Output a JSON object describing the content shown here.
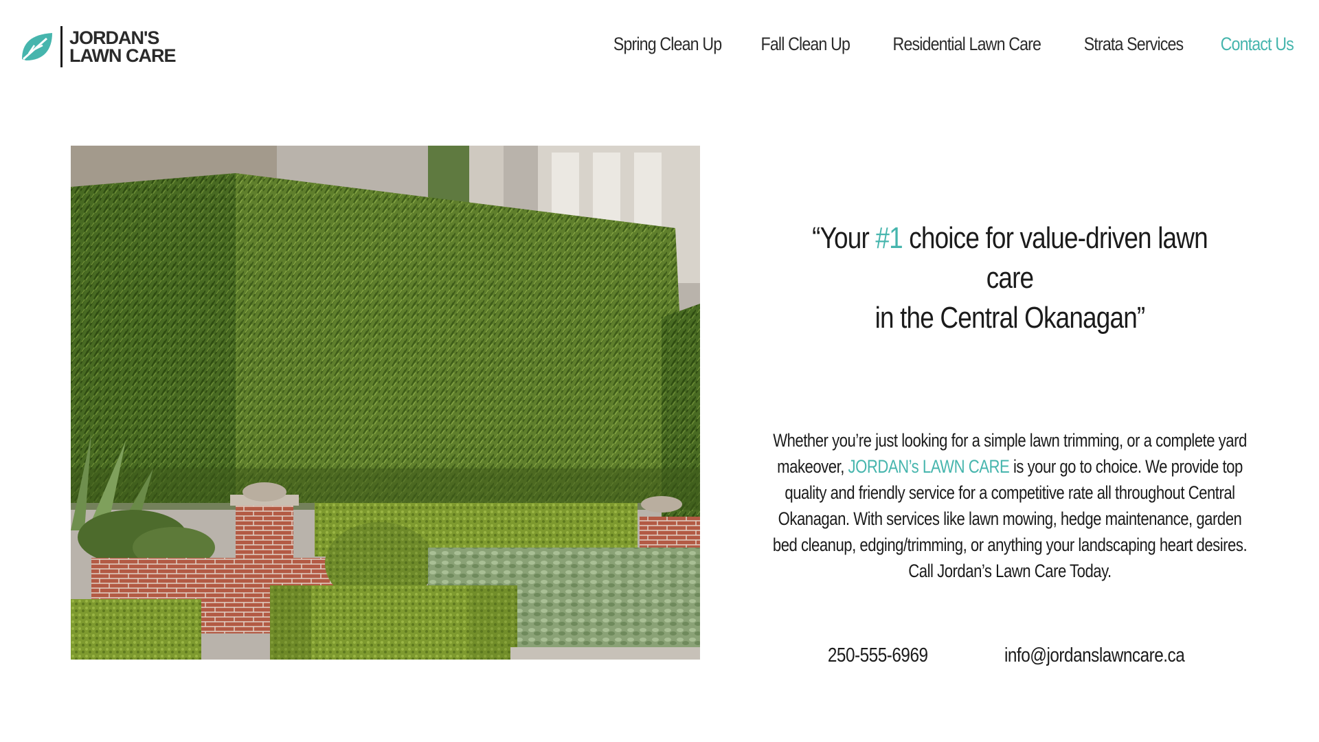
{
  "theme": {
    "accent": "#46b5ad",
    "text": "#1b1b1b"
  },
  "logo": {
    "line1": "JORDAN'S",
    "line2": "LAWN CARE",
    "icon": "leaf-icon"
  },
  "nav": {
    "items": [
      {
        "label": "Spring Clean Up",
        "active": false
      },
      {
        "label": "Fall Clean Up",
        "active": false
      },
      {
        "label": "Residential Lawn Care",
        "active": false
      },
      {
        "label": "Strata Services",
        "active": false
      },
      {
        "label": "Contact Us",
        "active": true
      }
    ]
  },
  "hero": {
    "image": "hedge-garden-photo"
  },
  "tagline": {
    "open_quote": "“Your ",
    "highlight": "#1",
    "rest_line1": " choice for value-driven lawn care",
    "line2": "in the Central Okanagan”"
  },
  "description": {
    "part1": "Whether you’re just looking for a simple lawn trimming, or a complete yard makeover, ",
    "brand": "JORDAN’s LAWN CARE",
    "part2": " is your go to choice. We provide top quality and friendly service for a competitive rate all throughout Central Okanagan. With services like lawn mowing, hedge maintenance, garden bed cleanup, edging/trimming, or anything your landscaping heart desires. Call Jordan’s Lawn Care Today."
  },
  "contact": {
    "phone": "250-555-6969",
    "email": "info@jordanslawncare.ca"
  }
}
